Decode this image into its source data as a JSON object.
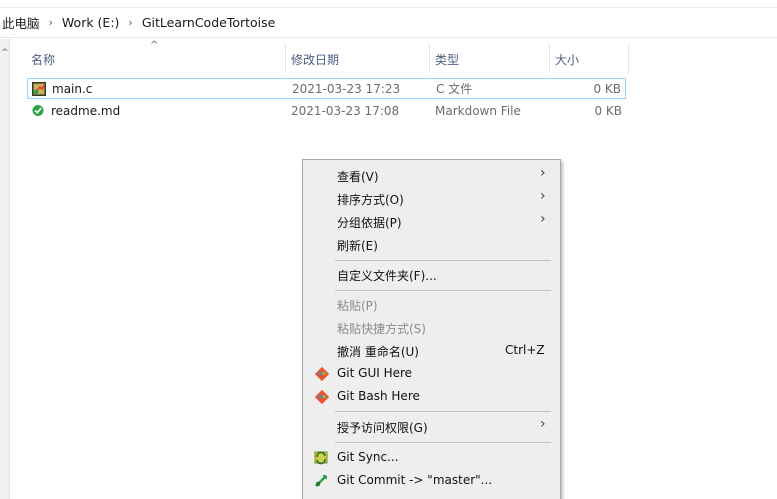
{
  "breadcrumb": {
    "items": [
      "此电脑",
      "Work (E:)",
      "GitLearnCodeTortoise"
    ],
    "separator": "›"
  },
  "columns": {
    "name": "名称",
    "date": "修改日期",
    "type": "类型",
    "size": "大小"
  },
  "files": [
    {
      "name": "main.c",
      "date": "2021-03-23 17:23",
      "type": "C 文件",
      "size": "0 KB",
      "icon": "c-file-modified-icon",
      "selected": true
    },
    {
      "name": "readme.md",
      "date": "2021-03-23 17:08",
      "type": "Markdown File",
      "size": "0 KB",
      "icon": "markdown-file-clean-icon",
      "selected": false
    }
  ],
  "context_menu": {
    "items": [
      {
        "label": "查看(V)",
        "submenu": true
      },
      {
        "label": "排序方式(O)",
        "submenu": true
      },
      {
        "label": "分组依据(P)",
        "submenu": true
      },
      {
        "label": "刷新(E)"
      },
      {
        "label": "自定义文件夹(F)..."
      },
      {
        "label": "粘贴(P)",
        "disabled": true
      },
      {
        "label": "粘贴快捷方式(S)",
        "disabled": true
      },
      {
        "label": "撤消 重命名(U)",
        "shortcut": "Ctrl+Z"
      },
      {
        "label": "Git GUI Here",
        "icon": "git-logo-icon"
      },
      {
        "label": "Git Bash Here",
        "icon": "git-logo-icon"
      },
      {
        "label": "授予访问权限(G)",
        "submenu": true
      },
      {
        "label": "Git Sync...",
        "icon": "tortoisegit-sync-icon"
      },
      {
        "label": "Git Commit -> \"master\"...",
        "icon": "tortoisegit-commit-icon"
      }
    ],
    "submenu_glyph": "›"
  },
  "colors": {
    "accent": "#99d1ff",
    "header_text": "#4d6082",
    "menu_bg": "#eeeeee",
    "git_orange": "#f05133",
    "status_green": "#2ea44f"
  }
}
